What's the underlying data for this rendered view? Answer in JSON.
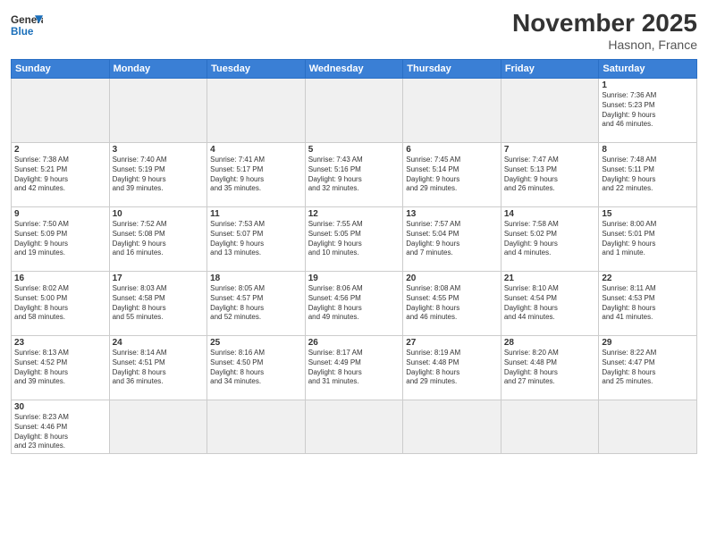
{
  "logo": {
    "general": "General",
    "blue": "Blue"
  },
  "title": "November 2025",
  "location": "Hasnon, France",
  "days_of_week": [
    "Sunday",
    "Monday",
    "Tuesday",
    "Wednesday",
    "Thursday",
    "Friday",
    "Saturday"
  ],
  "weeks": [
    [
      {
        "day": "",
        "info": "",
        "empty": true
      },
      {
        "day": "",
        "info": "",
        "empty": true
      },
      {
        "day": "",
        "info": "",
        "empty": true
      },
      {
        "day": "",
        "info": "",
        "empty": true
      },
      {
        "day": "",
        "info": "",
        "empty": true
      },
      {
        "day": "",
        "info": "",
        "empty": true
      },
      {
        "day": "1",
        "info": "Sunrise: 7:36 AM\nSunset: 5:23 PM\nDaylight: 9 hours\nand 46 minutes."
      }
    ],
    [
      {
        "day": "2",
        "info": "Sunrise: 7:38 AM\nSunset: 5:21 PM\nDaylight: 9 hours\nand 42 minutes."
      },
      {
        "day": "3",
        "info": "Sunrise: 7:40 AM\nSunset: 5:19 PM\nDaylight: 9 hours\nand 39 minutes."
      },
      {
        "day": "4",
        "info": "Sunrise: 7:41 AM\nSunset: 5:17 PM\nDaylight: 9 hours\nand 35 minutes."
      },
      {
        "day": "5",
        "info": "Sunrise: 7:43 AM\nSunset: 5:16 PM\nDaylight: 9 hours\nand 32 minutes."
      },
      {
        "day": "6",
        "info": "Sunrise: 7:45 AM\nSunset: 5:14 PM\nDaylight: 9 hours\nand 29 minutes."
      },
      {
        "day": "7",
        "info": "Sunrise: 7:47 AM\nSunset: 5:13 PM\nDaylight: 9 hours\nand 26 minutes."
      },
      {
        "day": "8",
        "info": "Sunrise: 7:48 AM\nSunset: 5:11 PM\nDaylight: 9 hours\nand 22 minutes."
      }
    ],
    [
      {
        "day": "9",
        "info": "Sunrise: 7:50 AM\nSunset: 5:09 PM\nDaylight: 9 hours\nand 19 minutes."
      },
      {
        "day": "10",
        "info": "Sunrise: 7:52 AM\nSunset: 5:08 PM\nDaylight: 9 hours\nand 16 minutes."
      },
      {
        "day": "11",
        "info": "Sunrise: 7:53 AM\nSunset: 5:07 PM\nDaylight: 9 hours\nand 13 minutes."
      },
      {
        "day": "12",
        "info": "Sunrise: 7:55 AM\nSunset: 5:05 PM\nDaylight: 9 hours\nand 10 minutes."
      },
      {
        "day": "13",
        "info": "Sunrise: 7:57 AM\nSunset: 5:04 PM\nDaylight: 9 hours\nand 7 minutes."
      },
      {
        "day": "14",
        "info": "Sunrise: 7:58 AM\nSunset: 5:02 PM\nDaylight: 9 hours\nand 4 minutes."
      },
      {
        "day": "15",
        "info": "Sunrise: 8:00 AM\nSunset: 5:01 PM\nDaylight: 9 hours\nand 1 minute."
      }
    ],
    [
      {
        "day": "16",
        "info": "Sunrise: 8:02 AM\nSunset: 5:00 PM\nDaylight: 8 hours\nand 58 minutes."
      },
      {
        "day": "17",
        "info": "Sunrise: 8:03 AM\nSunset: 4:58 PM\nDaylight: 8 hours\nand 55 minutes."
      },
      {
        "day": "18",
        "info": "Sunrise: 8:05 AM\nSunset: 4:57 PM\nDaylight: 8 hours\nand 52 minutes."
      },
      {
        "day": "19",
        "info": "Sunrise: 8:06 AM\nSunset: 4:56 PM\nDaylight: 8 hours\nand 49 minutes."
      },
      {
        "day": "20",
        "info": "Sunrise: 8:08 AM\nSunset: 4:55 PM\nDaylight: 8 hours\nand 46 minutes."
      },
      {
        "day": "21",
        "info": "Sunrise: 8:10 AM\nSunset: 4:54 PM\nDaylight: 8 hours\nand 44 minutes."
      },
      {
        "day": "22",
        "info": "Sunrise: 8:11 AM\nSunset: 4:53 PM\nDaylight: 8 hours\nand 41 minutes."
      }
    ],
    [
      {
        "day": "23",
        "info": "Sunrise: 8:13 AM\nSunset: 4:52 PM\nDaylight: 8 hours\nand 39 minutes."
      },
      {
        "day": "24",
        "info": "Sunrise: 8:14 AM\nSunset: 4:51 PM\nDaylight: 8 hours\nand 36 minutes."
      },
      {
        "day": "25",
        "info": "Sunrise: 8:16 AM\nSunset: 4:50 PM\nDaylight: 8 hours\nand 34 minutes."
      },
      {
        "day": "26",
        "info": "Sunrise: 8:17 AM\nSunset: 4:49 PM\nDaylight: 8 hours\nand 31 minutes."
      },
      {
        "day": "27",
        "info": "Sunrise: 8:19 AM\nSunset: 4:48 PM\nDaylight: 8 hours\nand 29 minutes."
      },
      {
        "day": "28",
        "info": "Sunrise: 8:20 AM\nSunset: 4:48 PM\nDaylight: 8 hours\nand 27 minutes."
      },
      {
        "day": "29",
        "info": "Sunrise: 8:22 AM\nSunset: 4:47 PM\nDaylight: 8 hours\nand 25 minutes."
      }
    ],
    [
      {
        "day": "30",
        "info": "Sunrise: 8:23 AM\nSunset: 4:46 PM\nDaylight: 8 hours\nand 23 minutes.",
        "last": true
      },
      {
        "day": "",
        "info": "",
        "empty": true,
        "last": true
      },
      {
        "day": "",
        "info": "",
        "empty": true,
        "last": true
      },
      {
        "day": "",
        "info": "",
        "empty": true,
        "last": true
      },
      {
        "day": "",
        "info": "",
        "empty": true,
        "last": true
      },
      {
        "day": "",
        "info": "",
        "empty": true,
        "last": true
      },
      {
        "day": "",
        "info": "",
        "empty": true,
        "last": true
      }
    ]
  ]
}
